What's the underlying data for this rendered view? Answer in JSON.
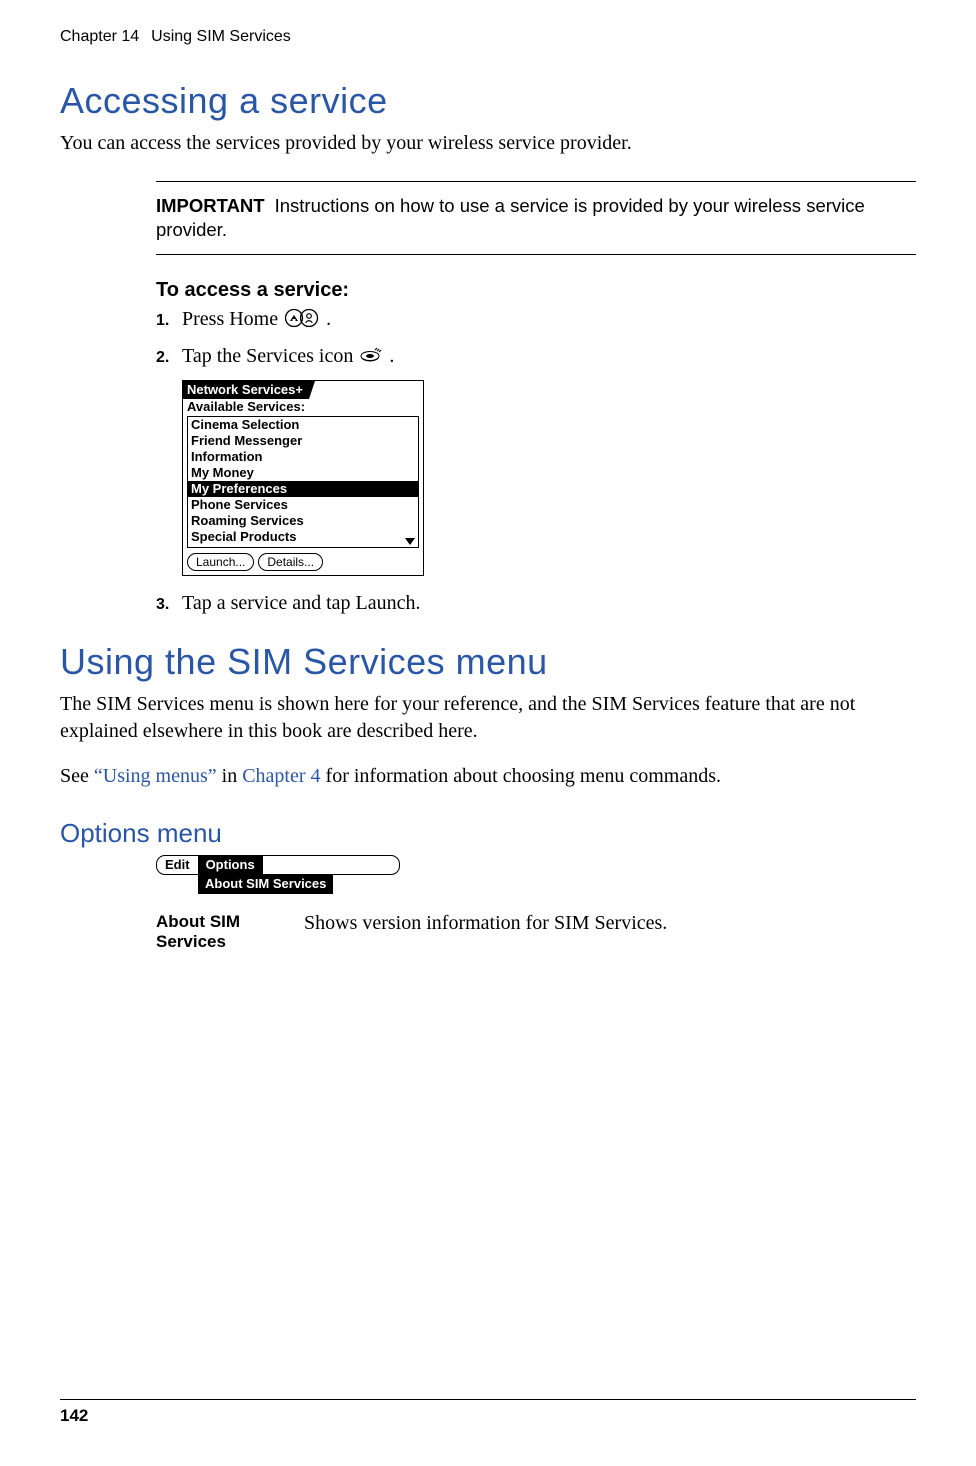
{
  "running_head": {
    "chapter": "Chapter 14",
    "title": "Using SIM Services"
  },
  "page_number": "142",
  "section_accessing": {
    "heading": "Accessing a service",
    "intro": "You can access the services provided by your wireless service provider.",
    "important_label": "IMPORTANT",
    "important_text": "Instructions on how to use a service is provided by your wireless service provider.",
    "proc_title": "To access a service:",
    "steps": {
      "s1_pre": "Press Home ",
      "s1_post": ".",
      "s2_pre": "Tap the Services icon ",
      "s2_post": ".",
      "s3": "Tap a service and tap Launch."
    },
    "palm": {
      "title": "Network Services+",
      "avail_label": "Available Services:",
      "items": [
        "Cinema Selection",
        "Friend Messenger",
        "Information",
        "My Money",
        "My Preferences",
        "Phone Services",
        "Roaming Services",
        "Special Products"
      ],
      "selected_index": 4,
      "btn_launch": "Launch...",
      "btn_details": "Details..."
    }
  },
  "section_menu": {
    "heading": "Using the SIM Services menu",
    "p1": "The SIM Services menu is shown here for your reference, and the SIM Services feature that are not explained elsewhere in this book are described here.",
    "p2_pre": "See ",
    "p2_link1": "“Using menus”",
    "p2_mid": " in ",
    "p2_link2": "Chapter 4",
    "p2_post": " for information about choosing menu commands."
  },
  "options": {
    "heading": "Options menu",
    "menubar": {
      "edit": "Edit",
      "options": "Options"
    },
    "dropdown_item": "About SIM Services",
    "def_term": "About SIM Services",
    "def_desc": "Shows version information for SIM Services."
  },
  "chart_data": null
}
